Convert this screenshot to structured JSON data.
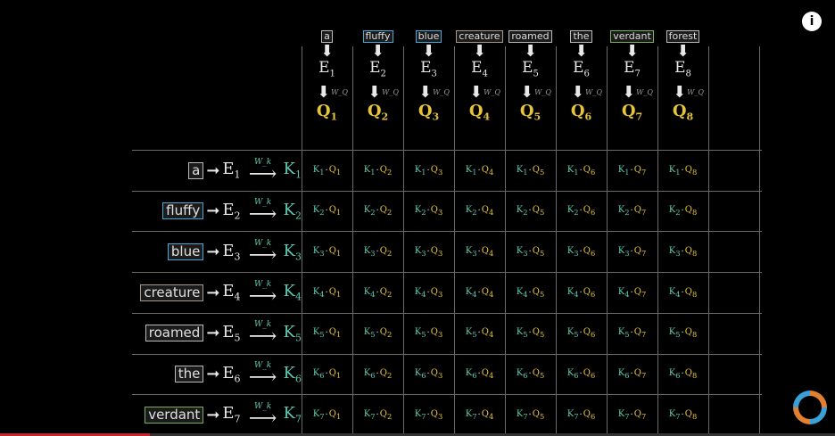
{
  "columns": [
    {
      "word": "a",
      "word_color": "#bbbbbb",
      "e_label": "E",
      "e_sub": "1",
      "wq_label": "W_Q",
      "q_label": "Q",
      "q_sub": "1"
    },
    {
      "word": "fluffy",
      "word_color": "#4aa8d8",
      "e_label": "E",
      "e_sub": "2",
      "wq_label": "W_Q",
      "q_label": "Q",
      "q_sub": "2"
    },
    {
      "word": "blue",
      "word_color": "#4aa8d8",
      "e_label": "E",
      "e_sub": "3",
      "wq_label": "W_Q",
      "q_label": "Q",
      "q_sub": "3"
    },
    {
      "word": "creature",
      "word_color": "#a89888",
      "e_label": "E",
      "e_sub": "4",
      "wq_label": "W_Q",
      "q_label": "Q",
      "q_sub": "4"
    },
    {
      "word": "roamed",
      "word_color": "#bbbbbb",
      "e_label": "E",
      "e_sub": "5",
      "wq_label": "W_Q",
      "q_label": "Q",
      "q_sub": "5"
    },
    {
      "word": "the",
      "word_color": "#bbbbbb",
      "e_label": "E",
      "e_sub": "6",
      "wq_label": "W_Q",
      "q_label": "Q",
      "q_sub": "6"
    },
    {
      "word": "verdant",
      "word_color": "#7bb060",
      "e_label": "E",
      "e_sub": "7",
      "wq_label": "W_Q",
      "q_label": "Q",
      "q_sub": "7"
    },
    {
      "word": "forest",
      "word_color": "#bbbbbb",
      "e_label": "E",
      "e_sub": "8",
      "wq_label": "W_Q",
      "q_label": "Q",
      "q_sub": "8"
    }
  ],
  "rows": [
    {
      "word": "a",
      "word_color": "#bbbbbb",
      "e_label": "E",
      "e_sub": "1",
      "wk_label": "W_k",
      "k_label": "K",
      "k_sub": "1"
    },
    {
      "word": "fluffy",
      "word_color": "#4aa8d8",
      "e_label": "E",
      "e_sub": "2",
      "wk_label": "W_k",
      "k_label": "K",
      "k_sub": "2"
    },
    {
      "word": "blue",
      "word_color": "#4aa8d8",
      "e_label": "E",
      "e_sub": "3",
      "wk_label": "W_k",
      "k_label": "K",
      "k_sub": "3"
    },
    {
      "word": "creature",
      "word_color": "#a89888",
      "e_label": "E",
      "e_sub": "4",
      "wk_label": "W_k",
      "k_label": "K",
      "k_sub": "4"
    },
    {
      "word": "roamed",
      "word_color": "#bbbbbb",
      "e_label": "E",
      "e_sub": "5",
      "wk_label": "W_k",
      "k_label": "K",
      "k_sub": "5"
    },
    {
      "word": "the",
      "word_color": "#bbbbbb",
      "e_label": "E",
      "e_sub": "6",
      "wk_label": "W_k",
      "k_label": "K",
      "k_sub": "6"
    },
    {
      "word": "verdant",
      "word_color": "#7bb060",
      "e_label": "E",
      "e_sub": "7",
      "wk_label": "W_k",
      "k_label": "K",
      "k_sub": "7"
    }
  ],
  "colors": {
    "query": "#e4c43a",
    "key": "#5fc9b0",
    "grid": "#6a6a6a",
    "background": "#000000"
  },
  "icons": {
    "info": "info-icon",
    "loading": "spinner-icon"
  },
  "info_label": "i",
  "video_progress_fraction": 0.18
}
